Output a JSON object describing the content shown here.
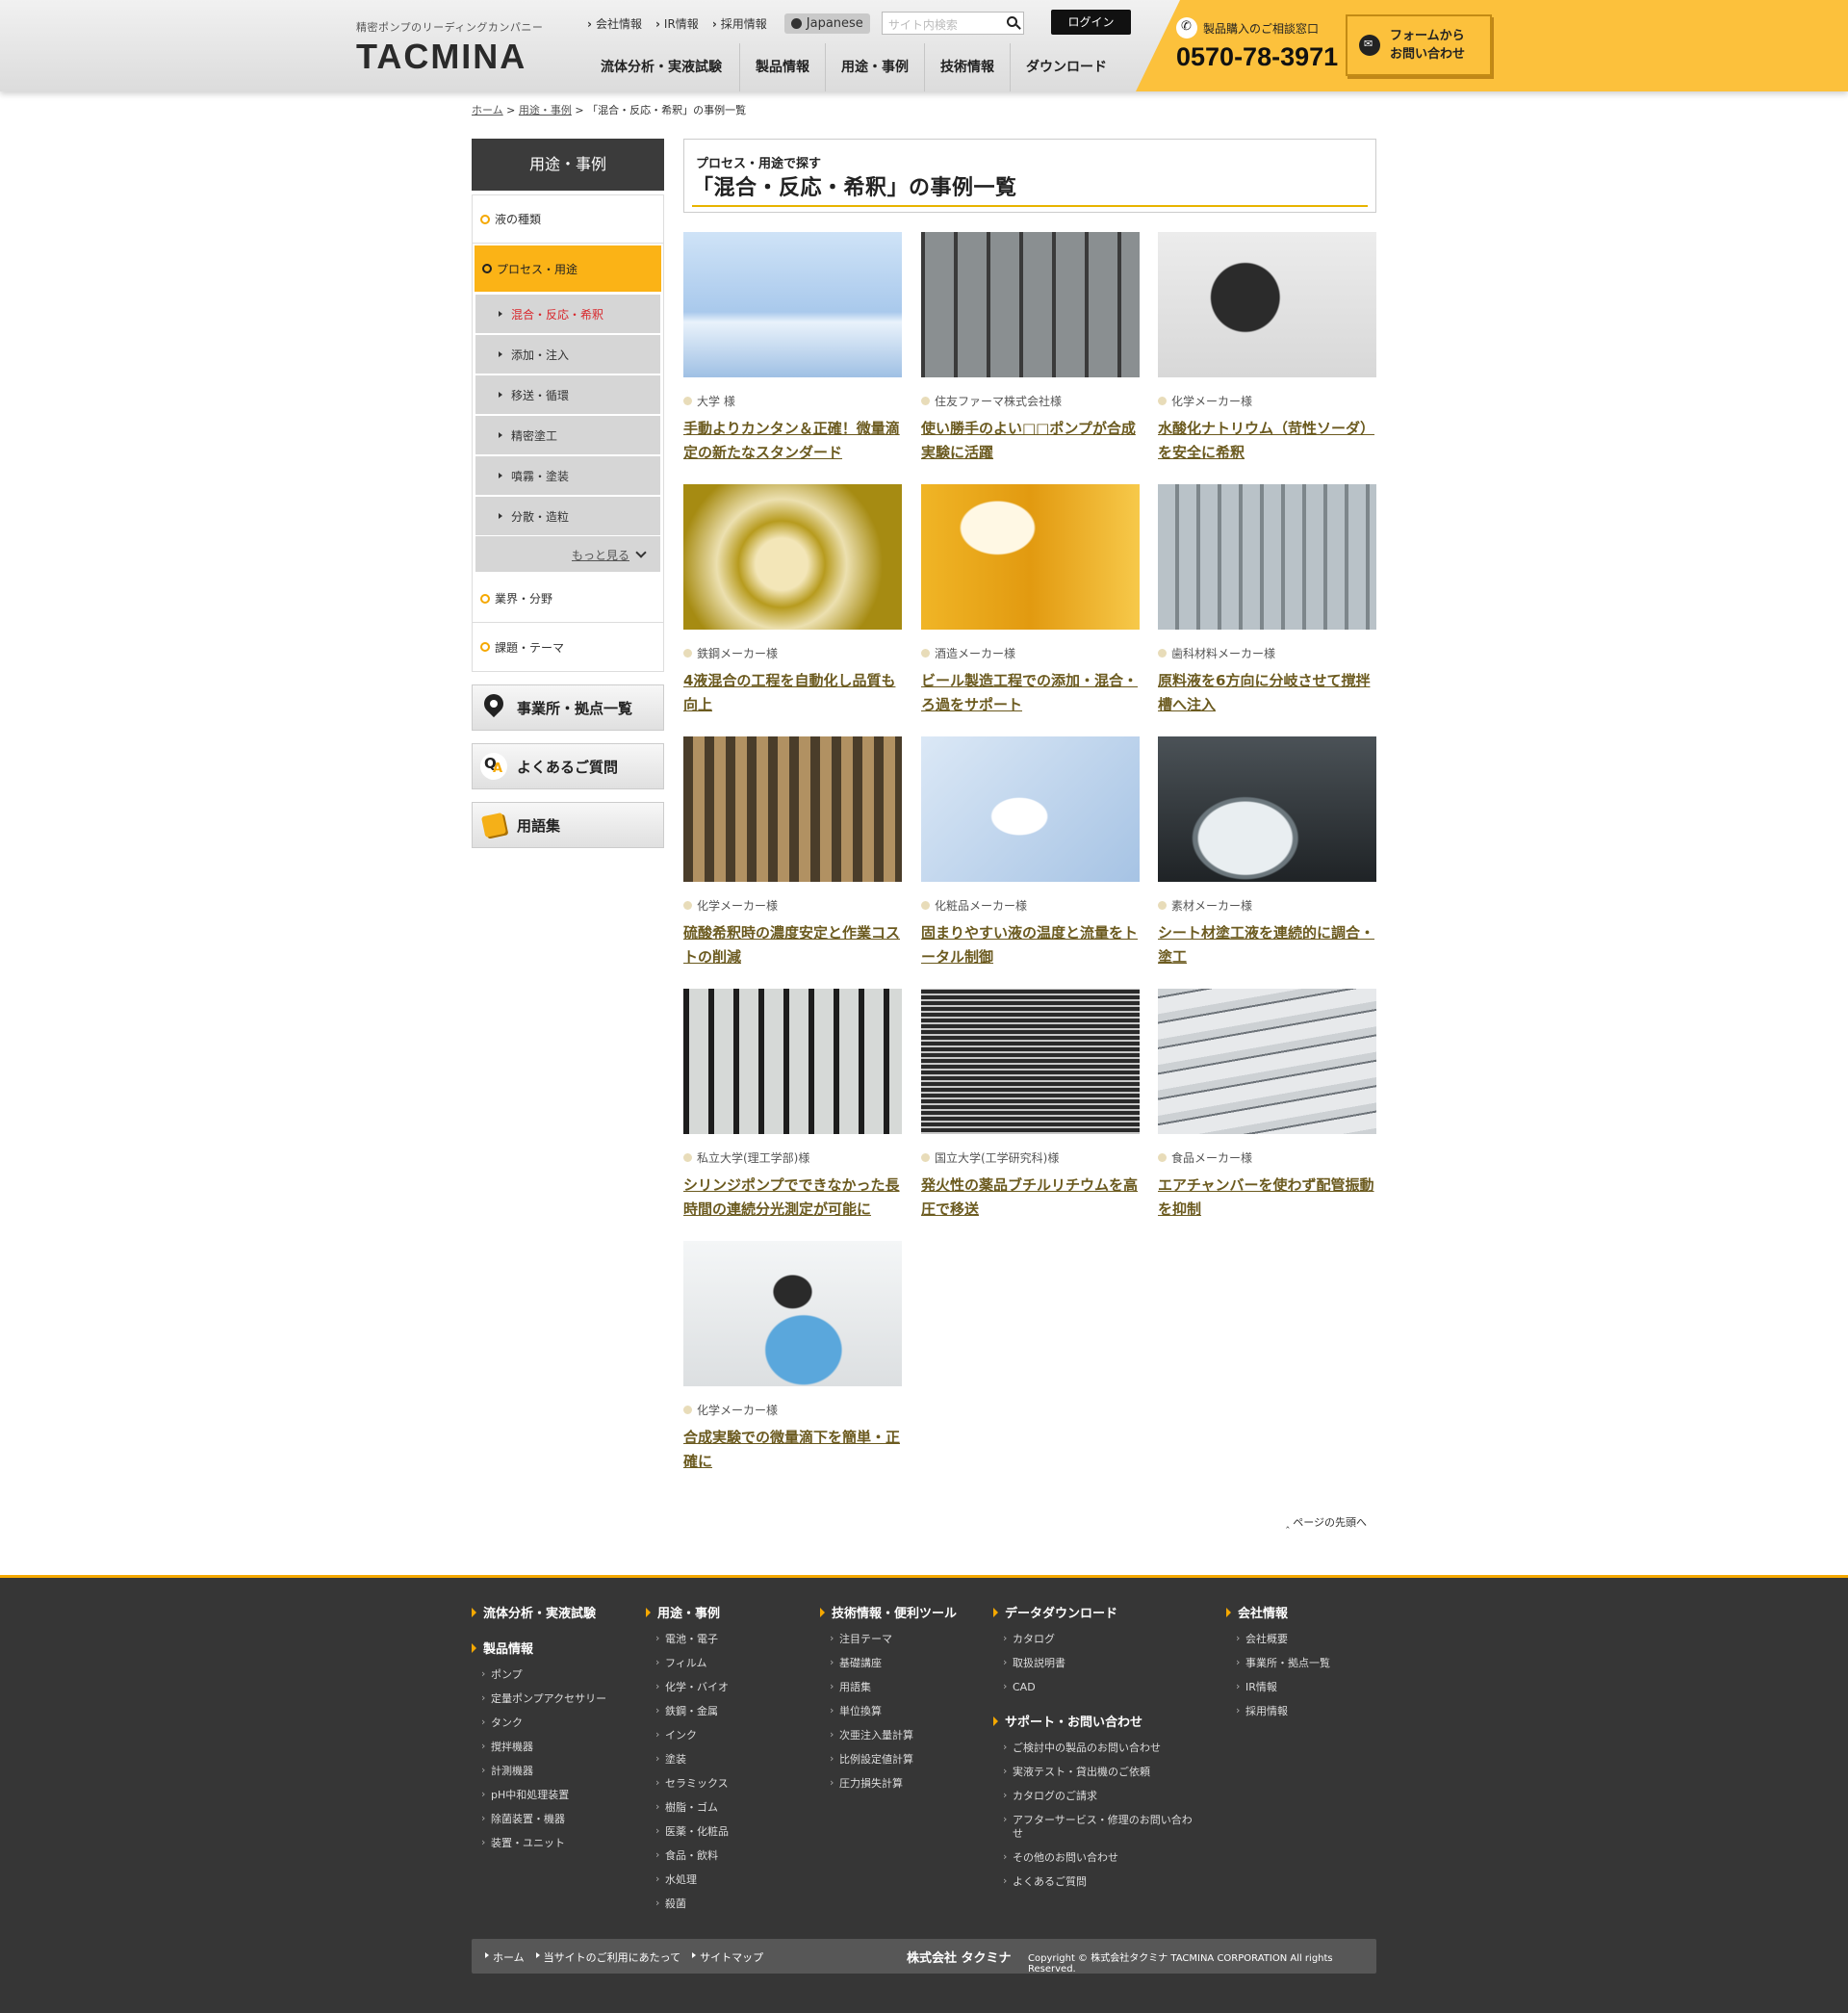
{
  "header": {
    "tagline": "精密ポンプのリーディングカンパニー",
    "logo": "TACMINA",
    "util_links": [
      "会社情報",
      "IR情報",
      "採用情報"
    ],
    "language": "Japanese",
    "search_placeholder": "サイト内検索",
    "login": "ログイン",
    "nav": [
      "流体分析・実液試験",
      "製品情報",
      "用途・事例",
      "技術情報",
      "ダウンロード"
    ],
    "tel_label": "製品購入のご相談窓口",
    "tel_number": "0570-78-3971",
    "form_button": "フォームから\nお問い合わせ",
    "accent_color": "#fcc13c"
  },
  "breadcrumb": {
    "home": "ホーム",
    "parent": "用途・事例",
    "sep": ">",
    "current": "「混合・反応・希釈」の事例一覧"
  },
  "sidebar": {
    "title": "用途・事例",
    "categories": [
      "液の種類",
      "プロセス・用途",
      "業界・分野",
      "課題・テーマ"
    ],
    "subitems": [
      "混合・反応・希釈",
      "添加・注入",
      "移送・循環",
      "精密塗工",
      "噴霧・塗装",
      "分散・造粒"
    ],
    "more": "もっと見る",
    "buttons": [
      "事業所・拠点一覧",
      "よくあるご質問",
      "用語集"
    ]
  },
  "page": {
    "subtitle": "プロセス・用途で探す",
    "title": "「混合・反応・希釈」の事例一覧",
    "back_to_top": "ページの先頭へ"
  },
  "cases": [
    {
      "client": "大学 様",
      "title": "手動よりカンタン＆正確！微量滴定の新たなスタンダード"
    },
    {
      "client": "住友ファーマ株式会社様",
      "title": "使い勝手のよい□□ポンプが合成実験に活躍"
    },
    {
      "client": "化学メーカー様",
      "title": "水酸化ナトリウム（苛性ソーダ）を安全に希釈"
    },
    {
      "client": "鉄鋼メーカー様",
      "title": "4液混合の工程を自動化し品質も向上"
    },
    {
      "client": "酒造メーカー様",
      "title": "ビール製造工程での添加・混合・ろ過をサポート"
    },
    {
      "client": "歯科材料メーカー様",
      "title": "原料液を6方向に分岐させて撹拌槽へ注入"
    },
    {
      "client": "化学メーカー様",
      "title": "硫酸希釈時の濃度安定と作業コストの削減"
    },
    {
      "client": "化粧品メーカー様",
      "title": "固まりやすい液の温度と流量をトータル制御"
    },
    {
      "client": "素材メーカー様",
      "title": "シート材塗工液を連続的に調合・塗工"
    },
    {
      "client": "私立大学(理工学部)様",
      "title": "シリンジポンプでできなかった長時間の連続分光測定が可能に"
    },
    {
      "client": "国立大学(工学研究科)様",
      "title": "発火性の薬品ブチルリチウムを高圧で移送"
    },
    {
      "client": "食品メーカー様",
      "title": "エアチャンバーを使わず配管振動を抑制"
    },
    {
      "client": "化学メーカー様",
      "title": "合成実験での微量滴下を簡単・正確に"
    }
  ],
  "footer": {
    "col1": {
      "h1": "流体分析・実液試験",
      "h2": "製品情報",
      "items": [
        "ポンプ",
        "定量ポンプアクセサリー",
        "タンク",
        "撹拌機器",
        "計測機器",
        "pH中和処理装置",
        "除菌装置・機器",
        "装置・ユニット"
      ]
    },
    "col2": {
      "h": "用途・事例",
      "items": [
        "電池・電子",
        "フィルム",
        "化学・バイオ",
        "鉄鋼・金属",
        "インク",
        "塗装",
        "セラミックス",
        "樹脂・ゴム",
        "医薬・化粧品",
        "食品・飲料",
        "水処理",
        "殺菌"
      ]
    },
    "col3": {
      "h": "技術情報・便利ツール",
      "items": [
        "注目テーマ",
        "基礎講座",
        "用語集",
        "単位換算",
        "次亜注入量計算",
        "比例設定値計算",
        "圧力損失計算"
      ]
    },
    "col4": {
      "h": "データダウンロード",
      "items": [
        "カタログ",
        "取扱説明書",
        "CAD"
      ],
      "h2": "サポート・お問い合わせ",
      "items2": [
        "ご検討中の製品のお問い合わせ",
        "実液テスト・貸出機のご依頼",
        "カタログのご請求",
        "アフターサービス・修理のお問い合わせ",
        "その他のお問い合わせ",
        "よくあるご質問"
      ]
    },
    "col5": {
      "h": "会社情報",
      "items": [
        "会社概要",
        "事業所・拠点一覧",
        "IR情報",
        "採用情報"
      ]
    },
    "bar_links": [
      "ホーム",
      "当サイトのご利用にあたって",
      "サイトマップ"
    ],
    "company": "株式会社 タクミナ",
    "copyright": "Copyright © 株式会社タクミナ TACMINA CORPORATION All rights Reserved."
  }
}
